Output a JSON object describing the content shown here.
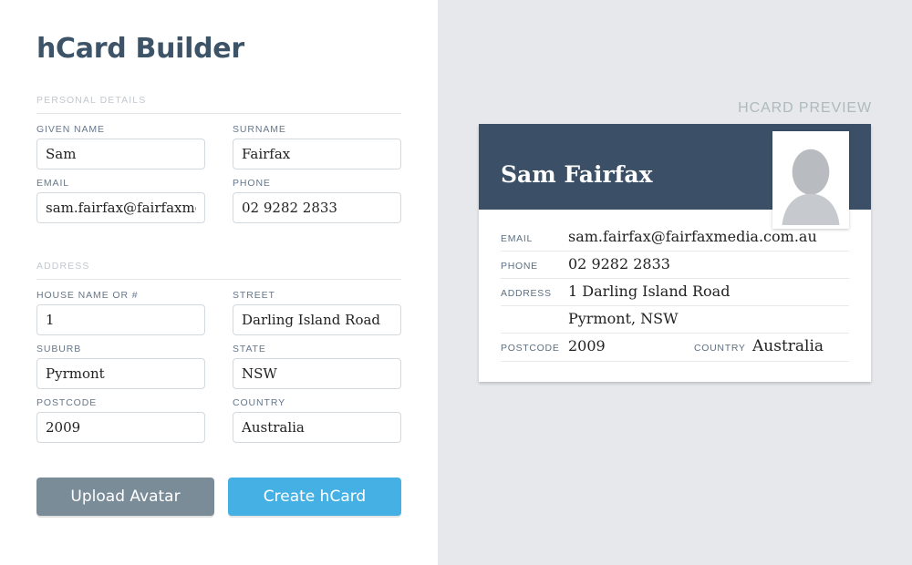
{
  "builder": {
    "title": "hCard Builder",
    "sections": [
      {
        "name": "personal-details",
        "label": "Personal Details",
        "fields": [
          {
            "name": "given-name",
            "label": "Given Name",
            "value": "Sam",
            "placeholder": "Given name"
          },
          {
            "name": "surname",
            "label": "Surname",
            "value": "Fairfax",
            "placeholder": "Surname"
          },
          {
            "name": "email",
            "label": "Email",
            "value": "sam.fairfax@fairfaxmedia.com.au",
            "placeholder": "Email"
          },
          {
            "name": "phone",
            "label": "Phone",
            "value": "02 9282 2833",
            "placeholder": "Phone"
          }
        ]
      },
      {
        "name": "address",
        "label": "Address",
        "fields": [
          {
            "name": "house-name-or-number",
            "label": "House name or #",
            "value": "1",
            "placeholder": "House name or #"
          },
          {
            "name": "street",
            "label": "Street",
            "value": "Darling Island Road",
            "placeholder": "Street"
          },
          {
            "name": "suburb",
            "label": "Suburb",
            "value": "Pyrmont",
            "placeholder": "Suburb"
          },
          {
            "name": "state",
            "label": "State",
            "value": "NSW",
            "placeholder": "State"
          },
          {
            "name": "postcode",
            "label": "Postcode",
            "value": "2009",
            "placeholder": "Postcode"
          },
          {
            "name": "country",
            "label": "Country",
            "value": "Australia",
            "placeholder": "Country"
          }
        ]
      }
    ],
    "buttons": {
      "upload_avatar": "Upload Avatar",
      "create_hcard": "Create hCard"
    }
  },
  "preview": {
    "title": "hCard Preview",
    "card": {
      "full_name": "Sam Fairfax",
      "avatar_icon": "person-placeholder-icon",
      "rows": {
        "email": {
          "label": "Email",
          "value": "sam.fairfax@fairfaxmedia.com.au"
        },
        "phone": {
          "label": "Phone",
          "value": "02 9282 2833"
        },
        "address_line1": {
          "label": "Address",
          "value": "1 Darling Island Road"
        },
        "address_line2": {
          "label": "",
          "value": "Pyrmont, NSW"
        },
        "postcode": {
          "label": "Postcode",
          "value": "2009"
        },
        "country": {
          "label": "Country",
          "value": "Australia"
        }
      }
    }
  },
  "colors": {
    "brand_navy": "#3b5066",
    "accent_blue": "#45b0e3",
    "upload_gray": "#7b8c99",
    "panel_bg": "#e6e8ec",
    "label_gray": "#66778a",
    "section_gray": "#c2c8cf"
  }
}
